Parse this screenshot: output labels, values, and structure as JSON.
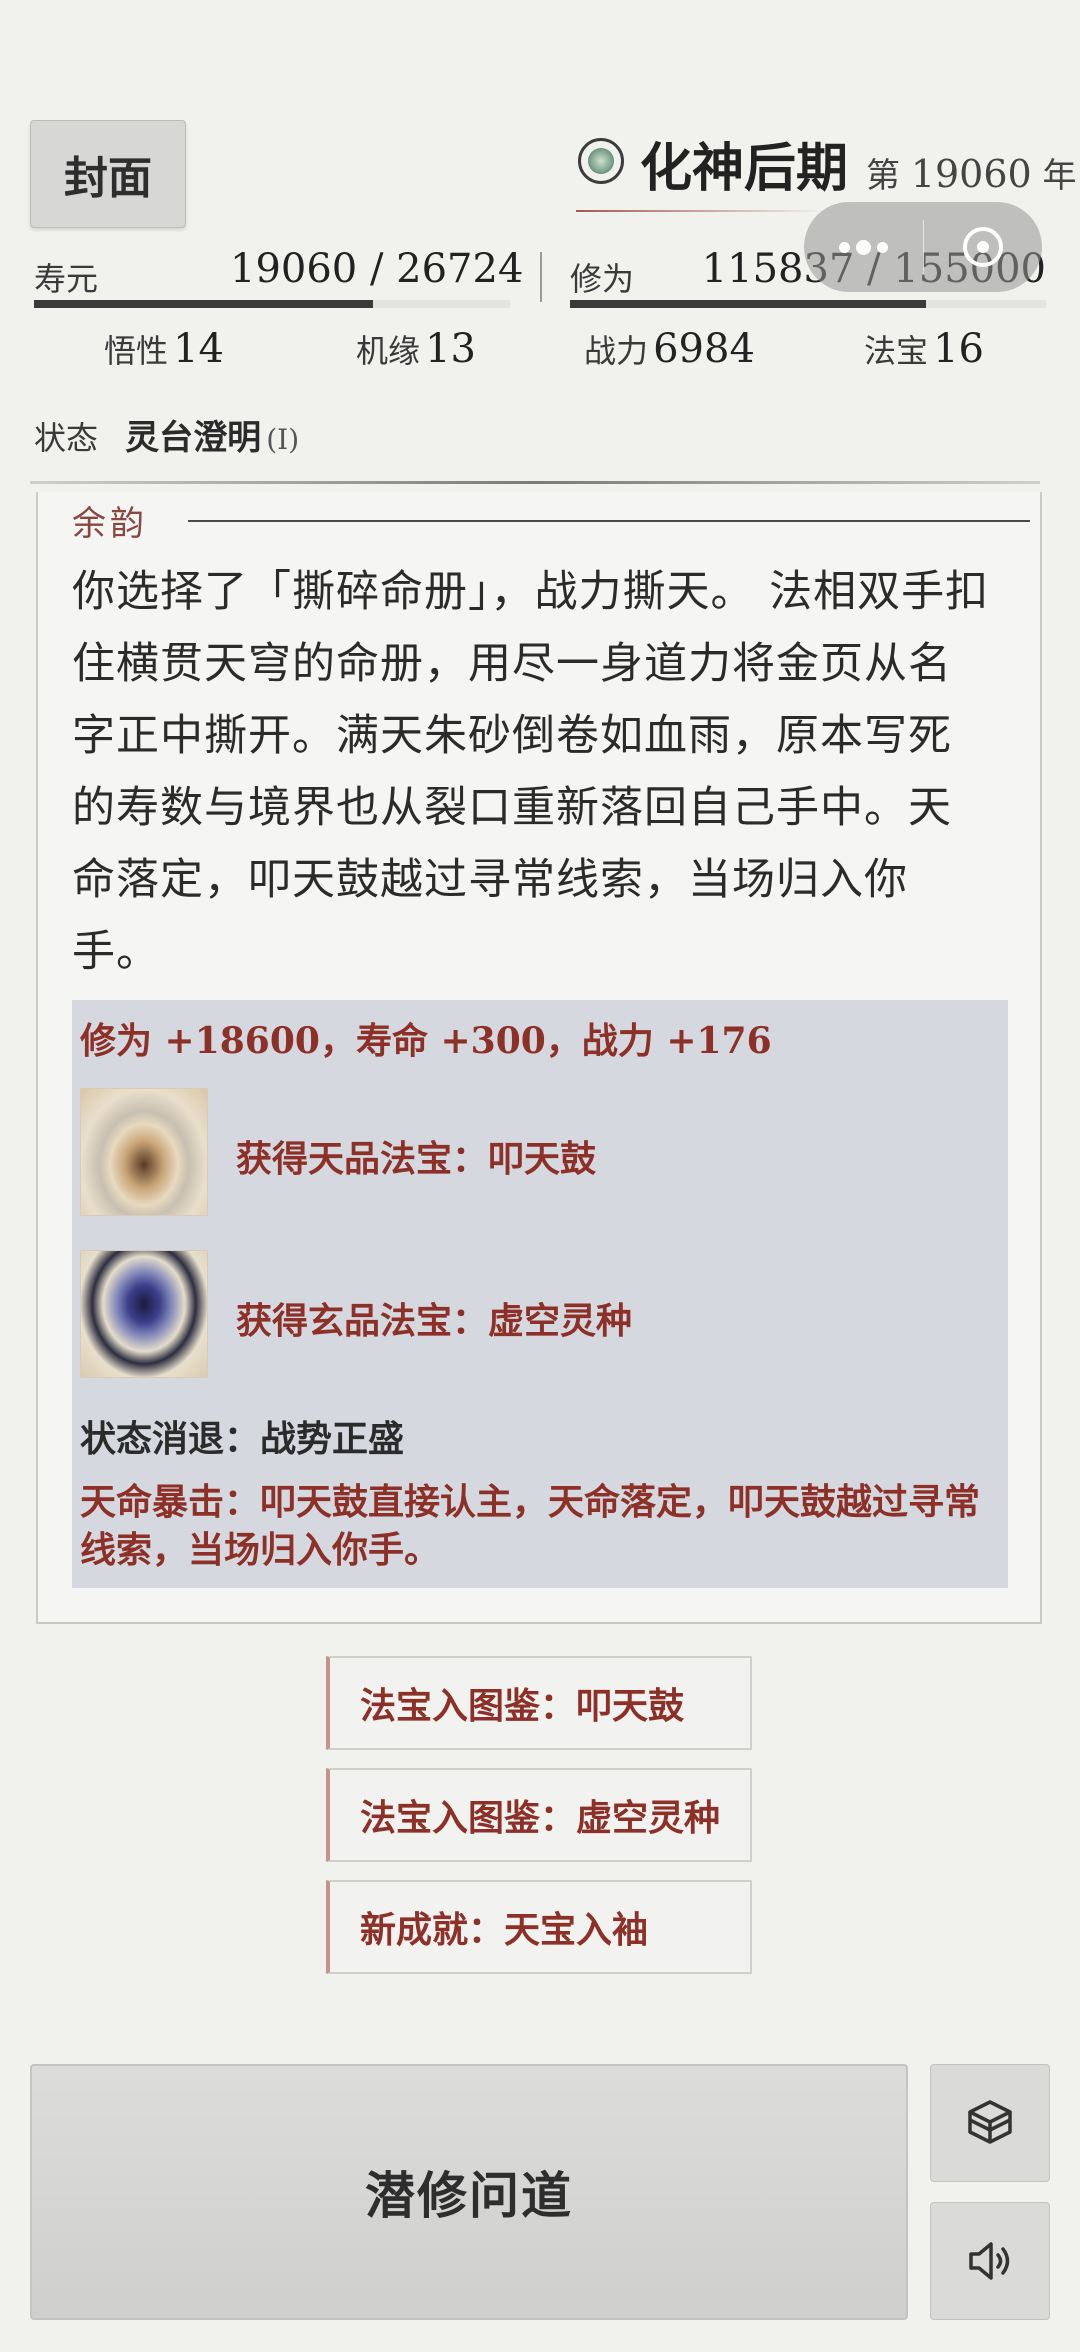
{
  "header": {
    "cover_label": "封面",
    "realm": "化神后期",
    "year_prefix": "第",
    "year_value": "19060",
    "year_suffix": "年"
  },
  "stats": {
    "lifespan_label": "寿元",
    "lifespan_value": "19060 / 26724",
    "lifespan_fraction": 0.713,
    "cultivation_label": "修为",
    "cultivation_value": "115837 / 155000",
    "cultivation_fraction": 0.747,
    "wuxing_label": "悟性",
    "wuxing_value": "14",
    "jiyuan_label": "机缘",
    "jiyuan_value": "13",
    "zhanli_label": "战力",
    "zhanli_value": "6984",
    "fabao_label": "法宝",
    "fabao_value": "16"
  },
  "status": {
    "label": "状态",
    "value": "灵台澄明",
    "level": "(I)"
  },
  "story": {
    "section_title": "余韵",
    "text": "你选择了「撕碎命册」，战力撕天。 法相双手扣住横贯天穹的命册，用尽一身道力将金页从名字正中撕开。满天朱砂倒卷如血雨，原本写死的寿数与境界也从裂口重新落回自己手中。天命落定，叩天鼓越过寻常线索，当场归入你手。"
  },
  "rewards": {
    "gains": "修为 +18600，寿命 +300，战力 +176",
    "treasures": [
      {
        "label": "获得天品法宝：叩天鼓",
        "icon": "heaven-drum-icon"
      },
      {
        "label": "获得玄品法宝：虚空灵种",
        "icon": "void-seed-icon"
      }
    ],
    "status_fade": "状态消退：战势正盛",
    "crit": "天命暴击：叩天鼓直接认主，天命落定，叩天鼓越过寻常线索，当场归入你手。"
  },
  "notices": [
    "法宝入图鉴：叩天鼓",
    "法宝入图鉴：虚空灵种",
    "新成就：天宝入袖"
  ],
  "actions": {
    "main_label": "潜修问道",
    "side_icons": [
      "cube-icon",
      "speaker-icon"
    ]
  },
  "colors": {
    "accent_red": "#8c3028",
    "reward_bg": "#d5d9df",
    "page_bg": "#f1f1ee"
  }
}
